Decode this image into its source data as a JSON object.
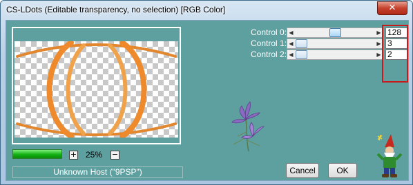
{
  "window": {
    "title": "CS-LDots (Editable transparency, no selection) [RGB Color]",
    "close_symbol": "✕"
  },
  "preview": {
    "zoom_label": "25%",
    "zoom_in_symbol": "+",
    "zoom_out_symbol": "−",
    "progress_fraction": 1.0
  },
  "status_text": "Unknown Host (\"9PSP\")",
  "controls": [
    {
      "label": "Control 0:",
      "value": "128",
      "fraction": 0.502
    },
    {
      "label": "Control 1:",
      "value": "3",
      "fraction": 0.012
    },
    {
      "label": "Control 2:",
      "value": "2",
      "fraction": 0.008
    }
  ],
  "buttons": {
    "cancel": "Cancel",
    "ok": "OK"
  },
  "colors": {
    "client_background": "#5ea0a0",
    "highlight": "#c81a1a",
    "arc_orange": "#e2872e",
    "progress_green": "#12b012"
  }
}
